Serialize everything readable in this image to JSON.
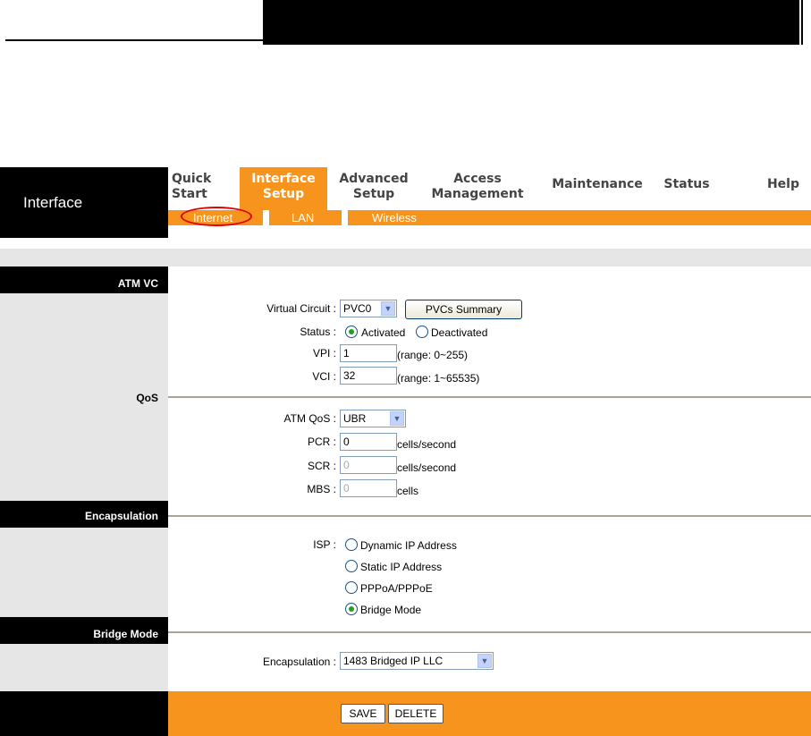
{
  "brand": "Interface",
  "menu": [
    {
      "line1": "Quick",
      "line2": "Start"
    },
    {
      "line1": "Interface",
      "line2": "Setup"
    },
    {
      "line1": "Advanced",
      "line2": "Setup"
    },
    {
      "line1": "Access",
      "line2": "Management"
    },
    {
      "line1": "Maintenance",
      "line2": ""
    },
    {
      "line1": "Status",
      "line2": ""
    },
    {
      "line1": "Help",
      "line2": ""
    }
  ],
  "submenu": [
    "Internet",
    "LAN",
    "Wireless"
  ],
  "sections": {
    "atm_vc": "ATM VC",
    "qos": "QoS",
    "encapsulation": "Encapsulation",
    "bridge_mode": "Bridge Mode"
  },
  "atm": {
    "virtual_circuit_label": "Virtual Circuit :",
    "virtual_circuit_value": "PVC0",
    "pvcs_summary_button": "PVCs Summary",
    "status_label": "Status :",
    "status_activated": "Activated",
    "status_deactivated": "Deactivated",
    "vpi_label": "VPI :",
    "vpi_value": "1",
    "vpi_range": "(range: 0~255)",
    "vci_label": "VCI :",
    "vci_value": "32",
    "vci_range": "(range: 1~65535)"
  },
  "qos": {
    "atm_qos_label": "ATM QoS :",
    "atm_qos_value": "UBR",
    "pcr_label": "PCR :",
    "pcr_value": "0",
    "pcr_unit": "cells/second",
    "scr_label": "SCR :",
    "scr_value": "0",
    "scr_unit": "cells/second",
    "mbs_label": "MBS :",
    "mbs_value": "0",
    "mbs_unit": "cells"
  },
  "isp": {
    "label": "ISP :",
    "options": [
      "Dynamic IP Address",
      "Static IP Address",
      "PPPoA/PPPoE",
      "Bridge Mode"
    ],
    "selected": "Bridge Mode"
  },
  "bridge": {
    "encapsulation_label": "Encapsulation :",
    "encapsulation_value": "1483 Bridged IP LLC"
  },
  "buttons": {
    "save": "SAVE",
    "delete": "DELETE"
  },
  "colors": {
    "accent": "#f7941d",
    "panel": "#e6e6e6",
    "dark": "#000000"
  }
}
